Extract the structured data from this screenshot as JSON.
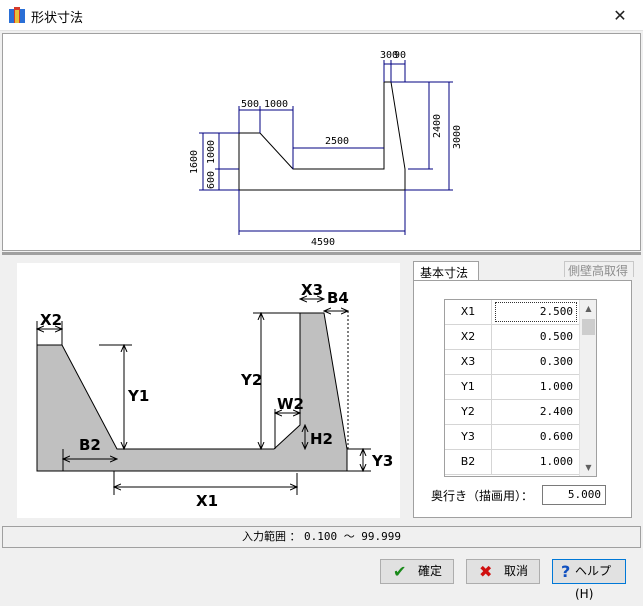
{
  "window": {
    "title": "形状寸法",
    "close_glyph": "✕"
  },
  "preview": {
    "labels": {
      "top_small_a": "300",
      "top_small_b": "90",
      "d500": "500",
      "d1000": "1000",
      "d2500": "2500",
      "d1600": "1600",
      "d1000v": "1000",
      "d600": "600",
      "d2400": "2400",
      "d3000": "3000",
      "d4590": "4590"
    }
  },
  "schematic": {
    "labels": {
      "x2": "X2",
      "y1": "Y1",
      "b2": "B2",
      "x1": "X1",
      "y2": "Y2",
      "w2": "W2",
      "h2": "H2",
      "x3": "X3",
      "b4": "B4",
      "y3": "Y3"
    }
  },
  "tabs": {
    "basic": "基本寸法",
    "side_wall": "側壁高取得"
  },
  "grid": {
    "rows": [
      {
        "name": "X1",
        "value": "2.500"
      },
      {
        "name": "X2",
        "value": "0.500"
      },
      {
        "name": "X3",
        "value": "0.300"
      },
      {
        "name": "Y1",
        "value": "1.000"
      },
      {
        "name": "Y2",
        "value": "2.400"
      },
      {
        "name": "Y3",
        "value": "0.600"
      },
      {
        "name": "B2",
        "value": "1.000"
      }
    ]
  },
  "depth": {
    "label": "奥行き（描画用）：",
    "value": "5.000"
  },
  "status": {
    "label": "入力範囲 ： ",
    "range": "0.100 ～ 99.999"
  },
  "buttons": {
    "ok": "確定",
    "cancel": "取消",
    "help": "ヘルプ(H)"
  }
}
